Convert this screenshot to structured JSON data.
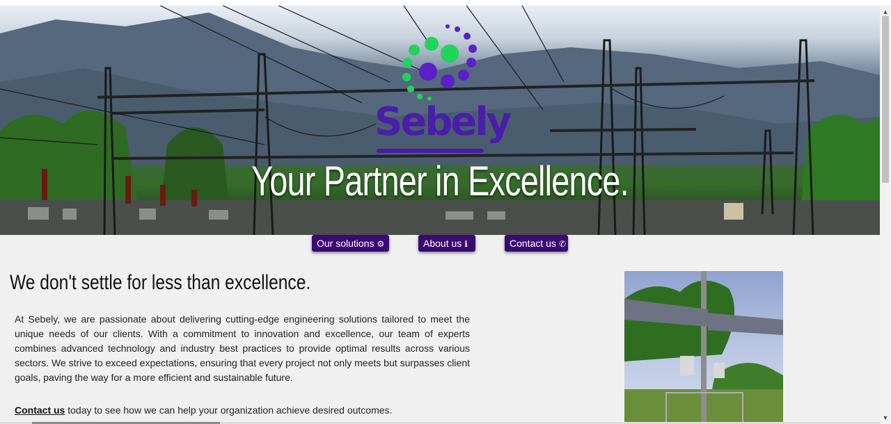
{
  "hero": {
    "brand": "Sebely",
    "tagline": "Your Partner in Excellence."
  },
  "nav_buttons": [
    {
      "label": "Our solutions",
      "icon": "gears-icon",
      "glyph": "⚙"
    },
    {
      "label": "About us",
      "icon": "info-circle-icon",
      "glyph": "ℹ"
    },
    {
      "label": "Contact us",
      "icon": "phone-icon",
      "glyph": "✆"
    }
  ],
  "main": {
    "heading": "We don't settle for less than excellence.",
    "paragraph": "At Sebely, we are passionate about delivering cutting-edge engineering solutions tailored to meet the unique needs of our clients. With a commitment to innovation and excellence, our team of experts combines advanced technology and industry best practices to provide optimal results across various sectors. We strive to exceed expectations, ensuring that every project not only meets but surpasses client goals, paving the way for a more efficient and sustainable future.",
    "cta_link": "Contact us",
    "cta_text": " today to see how we can help your organization achieve desired outcomes."
  },
  "colors": {
    "brand_purple": "#4a1ea8",
    "button_bg": "#3a0a73",
    "logo_green": "#1fd45a",
    "page_bg": "#f0f0f0"
  }
}
